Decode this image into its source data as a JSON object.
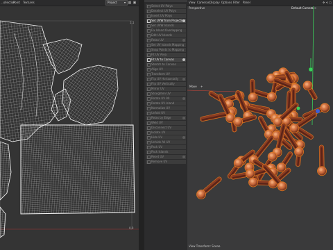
{
  "uv_editor": {
    "menu": [
      "...ollection",
      "Point",
      "Textures"
    ],
    "dropdown": "Project",
    "corner_label": "1,1",
    "origin_label": "0,0"
  },
  "commands": {
    "items": [
      {
        "label": "Select UV Polys",
        "active": false
      },
      {
        "label": "Deselect UV Polys",
        "active": false
      },
      {
        "label": "Invert UV Polys",
        "active": false
      },
      {
        "label": "Set UVW from Projection",
        "active": true
      },
      {
        "label": "Set UVW Islands",
        "active": false
      },
      {
        "label": "Fix Island Overlapping",
        "active": false
      },
      {
        "label": "Edit UV Islands",
        "active": false
      },
      {
        "label": "Relax UV",
        "active": false
      },
      {
        "label": "Set UV Islands Mapping",
        "active": false
      },
      {
        "label": "Snap Points to Mapping",
        "active": false
      },
      {
        "label": "Fit UV Area",
        "active": false
      },
      {
        "label": "Fit UV to Canvas",
        "active": true
      },
      {
        "label": "Stretch to Canvas",
        "active": false
      },
      {
        "label": "Align UV",
        "active": false
      },
      {
        "label": "Transform UV",
        "active": false
      },
      {
        "label": "Flip UV Horizontally",
        "active": false
      },
      {
        "label": "Flip UV Vertically",
        "active": false
      },
      {
        "label": "Mirror UV",
        "active": false
      },
      {
        "label": "Straighten UV",
        "active": false
      },
      {
        "label": "Rotate UV 90",
        "active": false
      },
      {
        "label": "Rotate UV Island",
        "active": false
      },
      {
        "label": "Normalize UV",
        "active": false
      },
      {
        "label": "Unfold UV",
        "active": false
      },
      {
        "label": "Relax by Edge",
        "active": false
      },
      {
        "label": "Weld UV",
        "active": false
      },
      {
        "label": "Disconnect UV",
        "active": false
      },
      {
        "label": "Isolate UV",
        "active": false
      },
      {
        "label": "Hide UV",
        "active": false
      },
      {
        "label": "Unhide All UV",
        "active": false
      },
      {
        "label": "Pack UV",
        "active": false
      },
      {
        "label": "Pack Islands",
        "active": false
      },
      {
        "label": "Reset UV",
        "active": false
      },
      {
        "label": "Remove UV",
        "active": false
      }
    ]
  },
  "viewport": {
    "menu": [
      "View",
      "Cameras",
      "Display",
      "Options",
      "Filter",
      "Panel"
    ],
    "view_name": "Perspective",
    "camera": "Default Camera",
    "tool_label": "Move",
    "status": "View Transform: Scene"
  },
  "colors": {
    "uv_panel_bg": "#343434",
    "uv_grid": "#ffffff",
    "viewport_bg": "#3a3a3b",
    "clove_dark": "#5a2418",
    "clove_mid": "#8a3c22",
    "clove_bud": "#c9693a",
    "axis_y": "#3bd15c",
    "axis_x": "#d2463c",
    "selection_outline": "#e07a20"
  },
  "icons": [
    "grid-icon",
    "lock-icon",
    "close-icon",
    "menu-icon",
    "maximize-icon"
  ]
}
